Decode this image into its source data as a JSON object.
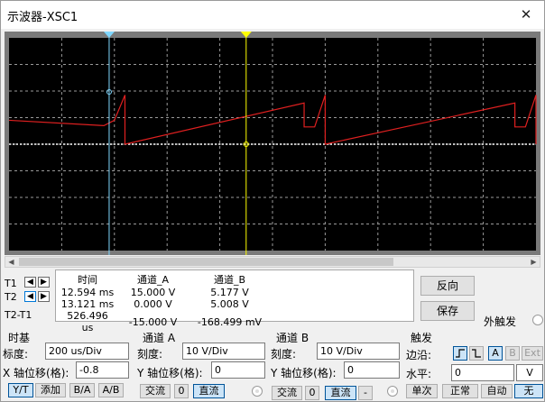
{
  "window": {
    "title": "示波器-XSC1",
    "close_glyph": "✕"
  },
  "readout": {
    "headers": [
      "时间",
      "通道_A",
      "通道_B"
    ],
    "rows": [
      {
        "label": "T1",
        "time": "12.594 ms",
        "a": "15.000 V",
        "b": "5.177 V"
      },
      {
        "label": "T2",
        "time": "13.121 ms",
        "a": "0.000 V",
        "b": "5.008 V"
      },
      {
        "label": "T2-T1",
        "time": "526.496 us",
        "a": "-15.000 V",
        "b": "-168.499 mV"
      }
    ]
  },
  "buttons": {
    "reverse": "反向",
    "save": "保存",
    "ext_trigger": "外触发"
  },
  "timebase": {
    "title": "时基",
    "scale_label": "标度:",
    "scale_value": "200 us/Div",
    "xpos_label": "X 轴位移(格):",
    "xpos_value": "-0.8",
    "modes": [
      "Y/T",
      "添加",
      "B/A",
      "A/B"
    ]
  },
  "channel_a": {
    "title": "通道 A",
    "scale_label": "刻度:",
    "scale_value": "10  V/Div",
    "ypos_label": "Y 轴位移(格):",
    "ypos_value": "0",
    "coupling": [
      "交流",
      "0",
      "直流"
    ]
  },
  "channel_b": {
    "title": "通道 B",
    "scale_label": "刻度:",
    "scale_value": "10  V/Div",
    "ypos_label": "Y 轴位移(格):",
    "ypos_value": "0",
    "coupling": [
      "交流",
      "0",
      "直流",
      "-"
    ]
  },
  "trigger": {
    "title": "触发",
    "edge_label": "边沿:",
    "edge_buttons": [
      "rising-edge-icon",
      "falling-edge-icon",
      "A",
      "B",
      "Ext"
    ],
    "level_label": "水平:",
    "level_value": "0",
    "level_unit": "V",
    "modes": [
      "单次",
      "正常",
      "自动",
      "无"
    ]
  },
  "cursors": {
    "t1_marker": "1",
    "t2_marker": "2"
  },
  "colors": {
    "screen": "#000000",
    "grid": "#9a9a9a",
    "channel_a": "#e02020",
    "channel_b": "#ffffff",
    "cursor1": "#80d8ff",
    "cursor2": "#ffff00"
  },
  "chart_data": {
    "type": "line",
    "title": "",
    "xlabel": "",
    "ylabel": "",
    "grid": true,
    "divisions": {
      "x": 10,
      "y": 8
    },
    "series": [
      {
        "channel": "A",
        "x": [
          0,
          1.8,
          1.8,
          2.0,
          2.2,
          2.2,
          5.6,
          5.6,
          5.8,
          6.0,
          6.0,
          9.6,
          9.6,
          9.8,
          10.0,
          10.0
        ],
        "y": [
          0.9,
          0.7,
          0.7,
          0.9,
          1.85,
          0.0,
          1.55,
          0.65,
          0.65,
          1.85,
          0.0,
          1.55,
          0.65,
          0.65,
          1.85,
          0.0
        ]
      },
      {
        "channel": "B",
        "x": [
          0,
          10
        ],
        "y": [
          0,
          0
        ]
      }
    ],
    "units": "div"
  }
}
